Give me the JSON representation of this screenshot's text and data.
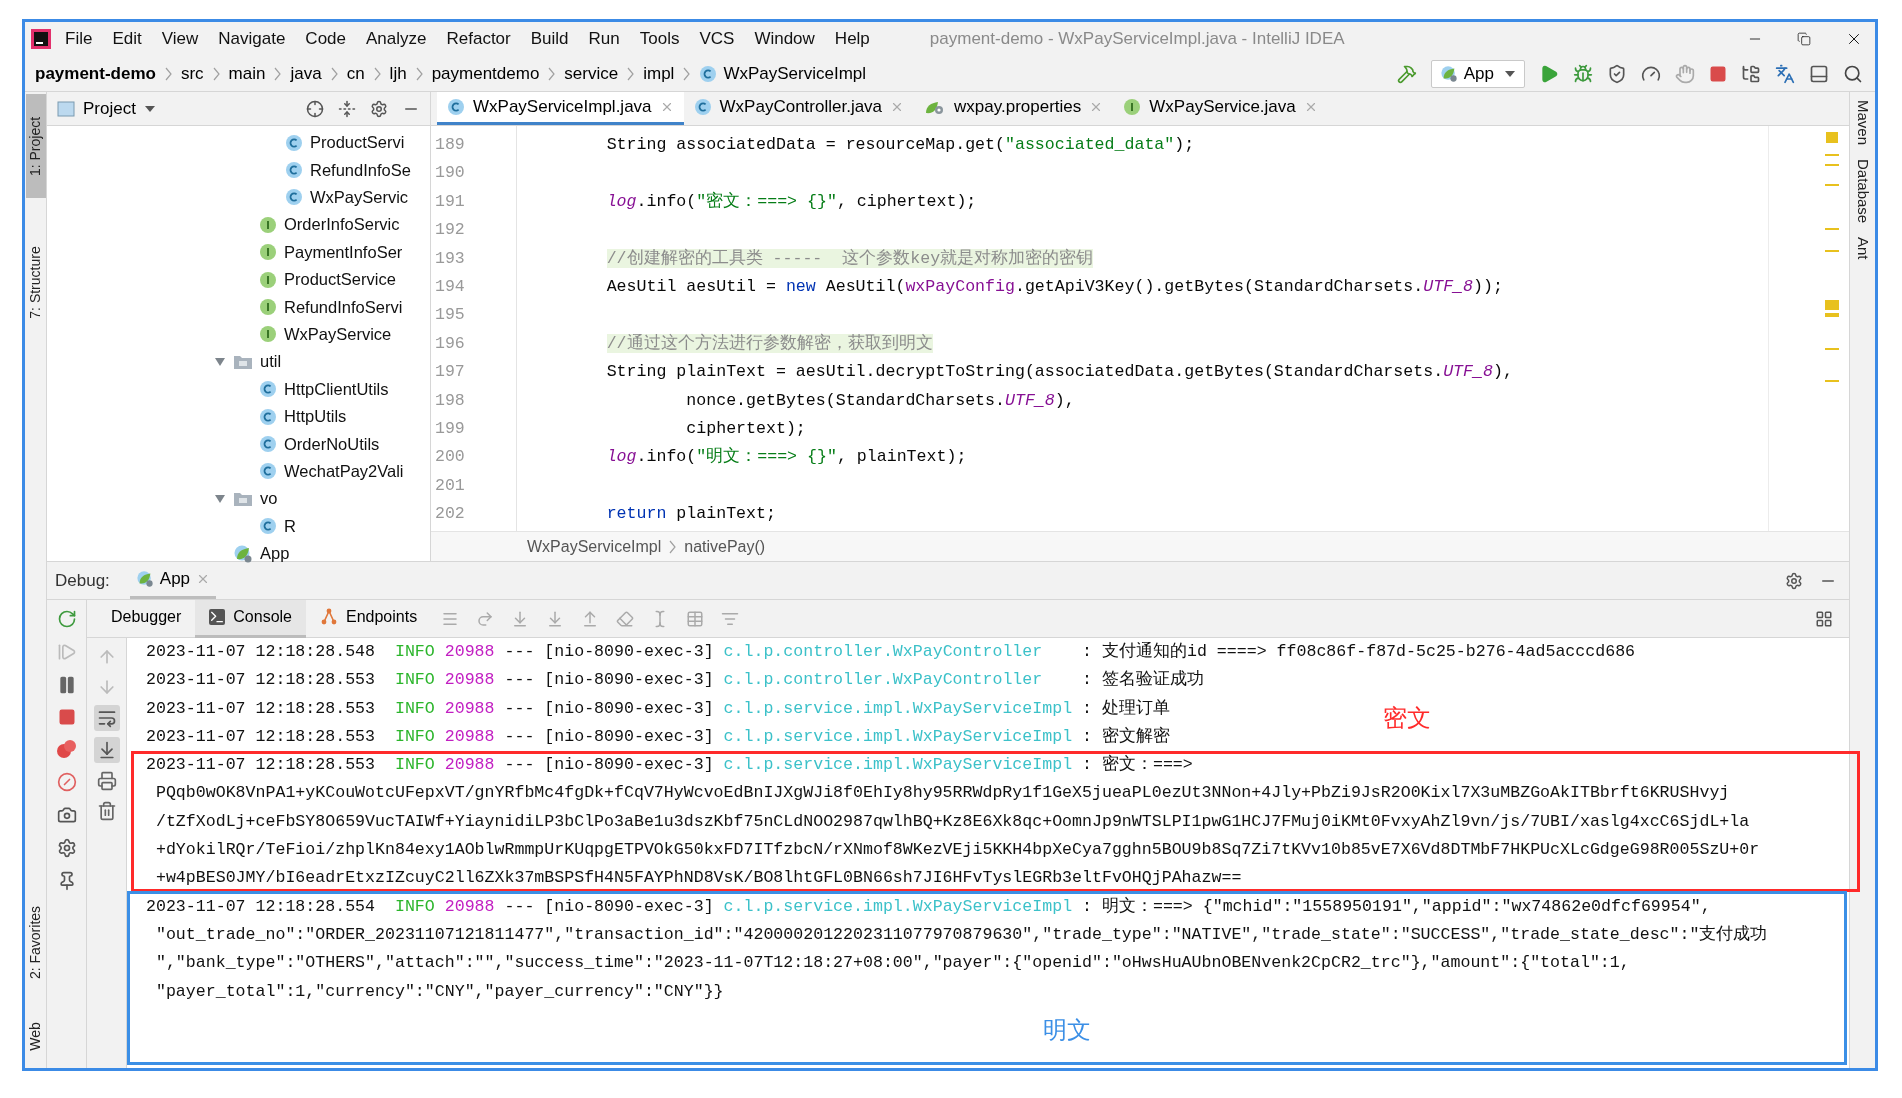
{
  "window": {
    "title": "payment-demo - WxPayServiceImpl.java - IntelliJ IDEA"
  },
  "menu": [
    "File",
    "Edit",
    "View",
    "Navigate",
    "Code",
    "Analyze",
    "Refactor",
    "Build",
    "Run",
    "Tools",
    "VCS",
    "Window",
    "Help"
  ],
  "breadcrumb": [
    {
      "label": "payment-demo",
      "kind": "project"
    },
    {
      "label": "src",
      "kind": "folder"
    },
    {
      "label": "main",
      "kind": "folder"
    },
    {
      "label": "java",
      "kind": "folder"
    },
    {
      "label": "cn",
      "kind": "folder"
    },
    {
      "label": "ljh",
      "kind": "folder"
    },
    {
      "label": "paymentdemo",
      "kind": "folder"
    },
    {
      "label": "service",
      "kind": "folder"
    },
    {
      "label": "impl",
      "kind": "folder"
    },
    {
      "label": "WxPayServiceImpl",
      "kind": "class"
    }
  ],
  "run_config": "App",
  "left_tool_tabs": [
    {
      "label": "1: Project",
      "selected": true
    },
    {
      "label": "7: Structure",
      "selected": false
    }
  ],
  "left_bottom_tool_tabs": [
    {
      "label": "2: Favorites",
      "selected": false
    },
    {
      "label": "Web",
      "selected": false
    }
  ],
  "right_tool_tabs": [
    "Maven",
    "Database",
    "Ant"
  ],
  "project_panel": {
    "title": "Project",
    "tree": [
      {
        "children": [
          {
            "children": [
              {
                "label": "ProductServi",
                "kind": "class"
              },
              {
                "label": "RefundInfoSe",
                "kind": "class"
              },
              {
                "label": "WxPayServic",
                "kind": "class"
              }
            ]
          },
          {
            "label": "OrderInfoServic",
            "kind": "interface"
          },
          {
            "label": "PaymentInfoSer",
            "kind": "interface"
          },
          {
            "label": "ProductService",
            "kind": "interface"
          },
          {
            "label": "RefundInfoServi",
            "kind": "interface"
          },
          {
            "label": "WxPayService",
            "kind": "interface"
          }
        ]
      },
      {
        "label": "util",
        "kind": "folder",
        "expanded": true,
        "children": [
          {
            "label": "HttpClientUtils",
            "kind": "class"
          },
          {
            "label": "HttpUtils",
            "kind": "class"
          },
          {
            "label": "OrderNoUtils",
            "kind": "class"
          },
          {
            "label": "WechatPay2Vali",
            "kind": "class"
          }
        ]
      },
      {
        "label": "vo",
        "kind": "folder",
        "expanded": true,
        "children": [
          {
            "label": "R",
            "kind": "class"
          }
        ]
      },
      {
        "label": "App",
        "kind": "app"
      }
    ]
  },
  "editor": {
    "tabs": [
      {
        "label": "WxPayServiceImpl.java",
        "kind": "class",
        "selected": true
      },
      {
        "label": "WxPayController.java",
        "kind": "class",
        "selected": false
      },
      {
        "label": "wxpay.properties",
        "kind": "properties",
        "selected": false
      },
      {
        "label": "WxPayService.java",
        "kind": "interface",
        "selected": false
      }
    ],
    "lines": [
      {
        "number": "189",
        "tokens": [
          {
            "kind": "plain",
            "text": "String associatedData = resourceMap.get("
          },
          {
            "kind": "string",
            "text": "\"associated_data\""
          },
          {
            "kind": "plain",
            "text": ");"
          }
        ]
      },
      {
        "number": "190"
      },
      {
        "number": "191",
        "tokens": [
          {
            "kind": "static",
            "text": "log"
          },
          {
            "kind": "plain",
            "text": ".info("
          },
          {
            "kind": "string",
            "text": "\"密文：===> {}\""
          },
          {
            "kind": "plain",
            "text": ", ciphertext);"
          }
        ]
      },
      {
        "number": "192"
      },
      {
        "number": "193",
        "tokens": [
          {
            "kind": "comment",
            "text": "//创建解密的工具类 -----  这个参数key就是对称加密的密钥"
          }
        ]
      },
      {
        "number": "194",
        "tokens": [
          {
            "kind": "plain",
            "text": "AesUtil aesUtil = "
          },
          {
            "kind": "keyword",
            "text": "new"
          },
          {
            "kind": "plain",
            "text": " AesUtil("
          },
          {
            "kind": "field",
            "text": "wxPayConfig"
          },
          {
            "kind": "plain",
            "text": ".getApiV3Key().getBytes(StandardCharsets."
          },
          {
            "kind": "static",
            "text": "UTF_8"
          },
          {
            "kind": "plain",
            "text": "));"
          }
        ]
      },
      {
        "number": "195"
      },
      {
        "number": "196",
        "tokens": [
          {
            "kind": "comment",
            "text": "//通过这个方法进行参数解密，获取到明文"
          }
        ]
      },
      {
        "number": "197",
        "tokens": [
          {
            "kind": "plain",
            "text": "String plainText = aesUtil.decryptToString(associatedData.getBytes(StandardCharsets."
          },
          {
            "kind": "static",
            "text": "UTF_8"
          },
          {
            "kind": "plain",
            "text": "),"
          }
        ]
      },
      {
        "number": "198",
        "tokens": [
          {
            "kind": "plain",
            "text": "        nonce.getBytes(StandardCharsets."
          },
          {
            "kind": "static",
            "text": "UTF_8"
          },
          {
            "kind": "plain",
            "text": "),"
          }
        ]
      },
      {
        "number": "199",
        "tokens": [
          {
            "kind": "plain",
            "text": "        ciphertext);"
          }
        ]
      },
      {
        "number": "200",
        "tokens": [
          {
            "kind": "static",
            "text": "log"
          },
          {
            "kind": "plain",
            "text": ".info("
          },
          {
            "kind": "string",
            "text": "\"明文：===> {}\""
          },
          {
            "kind": "plain",
            "text": ", plainText);"
          }
        ]
      },
      {
        "number": "201"
      },
      {
        "number": "202",
        "tokens": [
          {
            "kind": "keyword",
            "text": "return"
          },
          {
            "kind": "plain",
            "text": " plainText;"
          }
        ]
      }
    ],
    "breadcrumb": [
      "WxPayServiceImpl",
      "nativePay()"
    ]
  },
  "debug": {
    "label": "Debug:",
    "session_tab": "App",
    "tabs": [
      {
        "label": "Debugger",
        "kind": "debugger",
        "selected": false
      },
      {
        "label": "Console",
        "kind": "console",
        "selected": true
      },
      {
        "label": "Endpoints",
        "kind": "endpoints",
        "selected": false
      }
    ],
    "toggles": {
      "soft_wrap": true,
      "scroll_to_end": true
    },
    "console": [
      {
        "time": "2023-11-07 12:18:28.548",
        "level": "INFO",
        "pid": "20988",
        "sep": "---",
        "thread": "[nio-8090-exec-3]",
        "logger": "c.l.p.controller.WxPayController",
        "message": ": 支付通知的id ====> ff08c86f-f87d-5c25-b276-4ad5acccd686"
      },
      {
        "time": "2023-11-07 12:18:28.553",
        "level": "INFO",
        "pid": "20988",
        "sep": "---",
        "thread": "[nio-8090-exec-3]",
        "logger": "c.l.p.controller.WxPayController",
        "message": ": 签名验证成功"
      },
      {
        "time": "2023-11-07 12:18:28.553",
        "level": "INFO",
        "pid": "20988",
        "sep": "---",
        "thread": "[nio-8090-exec-3]",
        "logger": "c.l.p.service.impl.WxPayServiceImpl",
        "message": ": 处理订单"
      },
      {
        "time": "2023-11-07 12:18:28.553",
        "level": "INFO",
        "pid": "20988",
        "sep": "---",
        "thread": "[nio-8090-exec-3]",
        "logger": "c.l.p.service.impl.WxPayServiceImpl",
        "message": ": 密文解密"
      },
      {
        "time": "2023-11-07 12:18:28.553",
        "level": "INFO",
        "pid": "20988",
        "sep": "---",
        "thread": "[nio-8090-exec-3]",
        "logger": "c.l.p.service.impl.WxPayServiceImpl",
        "message": ": 密文：===>",
        "continuation": [
          "PQqb0wOK8VnPA1+yKCouWotcUFepxVT/gnYRfbMc4fgDk+fCqV7HyWcvoEdBnIJXgWJi8f0EhIy8hy95RRWdpRy1f1GeX5jueaPL0ezUt3NNon+4Jly+PbZi9JsR2O0Kixl7X3uMBZGoAkITBbrft6KRUSHvyj",
          "/tZfXodLj+ceFbSY8O659VucTAIWf+YiaynidiLP3bClPo3aBe1u3dszKbf75nCLdNOO2987qwlhBQ+Kz8E6Xk8qc+OomnJp9nWTSLPI1pwG1HCJ7FMuj0iKMt0FvxyAhZl9vn/js/7UBI/xaslg4xcC6SjdL+la",
          "+dYokilRQr/TeFioi/zhplKn84exy1AOblwRmmpUrKUqpgETPVOkG50kxFD7ITfzbcN/rXNmof8WKezVEji5KKH4bpXeCya7gghn5BOU9b8Sq7Zi7tKVv10b85vE7X6Vd8DTMbF7HKPUcXLcGdgeG98R005SzU+0r",
          "+w4pBES0JMY/bI6eadrEtxzIZcuyC2ll6ZXk37mBSPSfH4N5FAYPhND8VsK/BO8lhtGFL0BN66sh7JI6HFvTyslEGRb3eltFvOHQjPAhazw=="
        ]
      },
      {
        "time": "2023-11-07 12:18:28.554",
        "level": "INFO",
        "pid": "20988",
        "sep": "---",
        "thread": "[nio-8090-exec-3]",
        "logger": "c.l.p.service.impl.WxPayServiceImpl",
        "message": ": 明文：===> {\"mchid\":\"1558950191\",\"appid\":\"wx74862e0dfcf69954\",",
        "continuation": [
          "\"out_trade_no\":\"ORDER_20231107121811477\",\"transaction_id\":\"4200002012202311077970879630\",\"trade_type\":\"NATIVE\",\"trade_state\":\"SUCCESS\",\"trade_state_desc\":\"支付成功",
          "\",\"bank_type\":\"OTHERS\",\"attach\":\"\",\"success_time\":\"2023-11-07T12:18:27+08:00\",\"payer\":{\"openid\":\"oHwsHuAUbnOBENvenk2CpCR2_trc\"},\"amount\":{\"total\":1,",
          "\"payer_total\":1,\"currency\":\"CNY\",\"payer_currency\":\"CNY\"}}"
        ]
      }
    ]
  },
  "annotations": [
    {
      "label": "密文",
      "color": "#ff2a2a"
    },
    {
      "label": "明文",
      "color": "#3b8fe6"
    }
  ]
}
